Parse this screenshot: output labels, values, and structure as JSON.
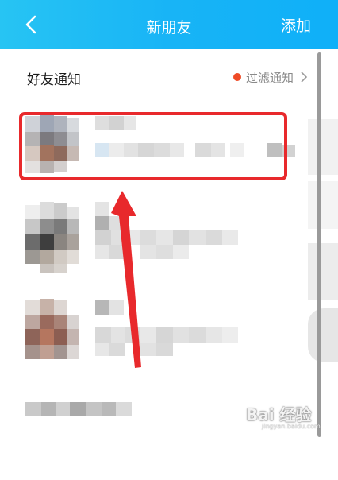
{
  "header": {
    "title": "新朋友",
    "add_label": "添加",
    "back_icon": "chevron-left-icon"
  },
  "notifications": {
    "section_title": "好友通知",
    "filter_label": "过滤通知",
    "filter_dot_color": "#ef4b26",
    "chevron_icon": "chevron-right-icon"
  },
  "annotation": {
    "color": "#e8292c"
  },
  "watermark": {
    "text": "Bai 经验",
    "sub": "jingyan.baidu.com"
  }
}
